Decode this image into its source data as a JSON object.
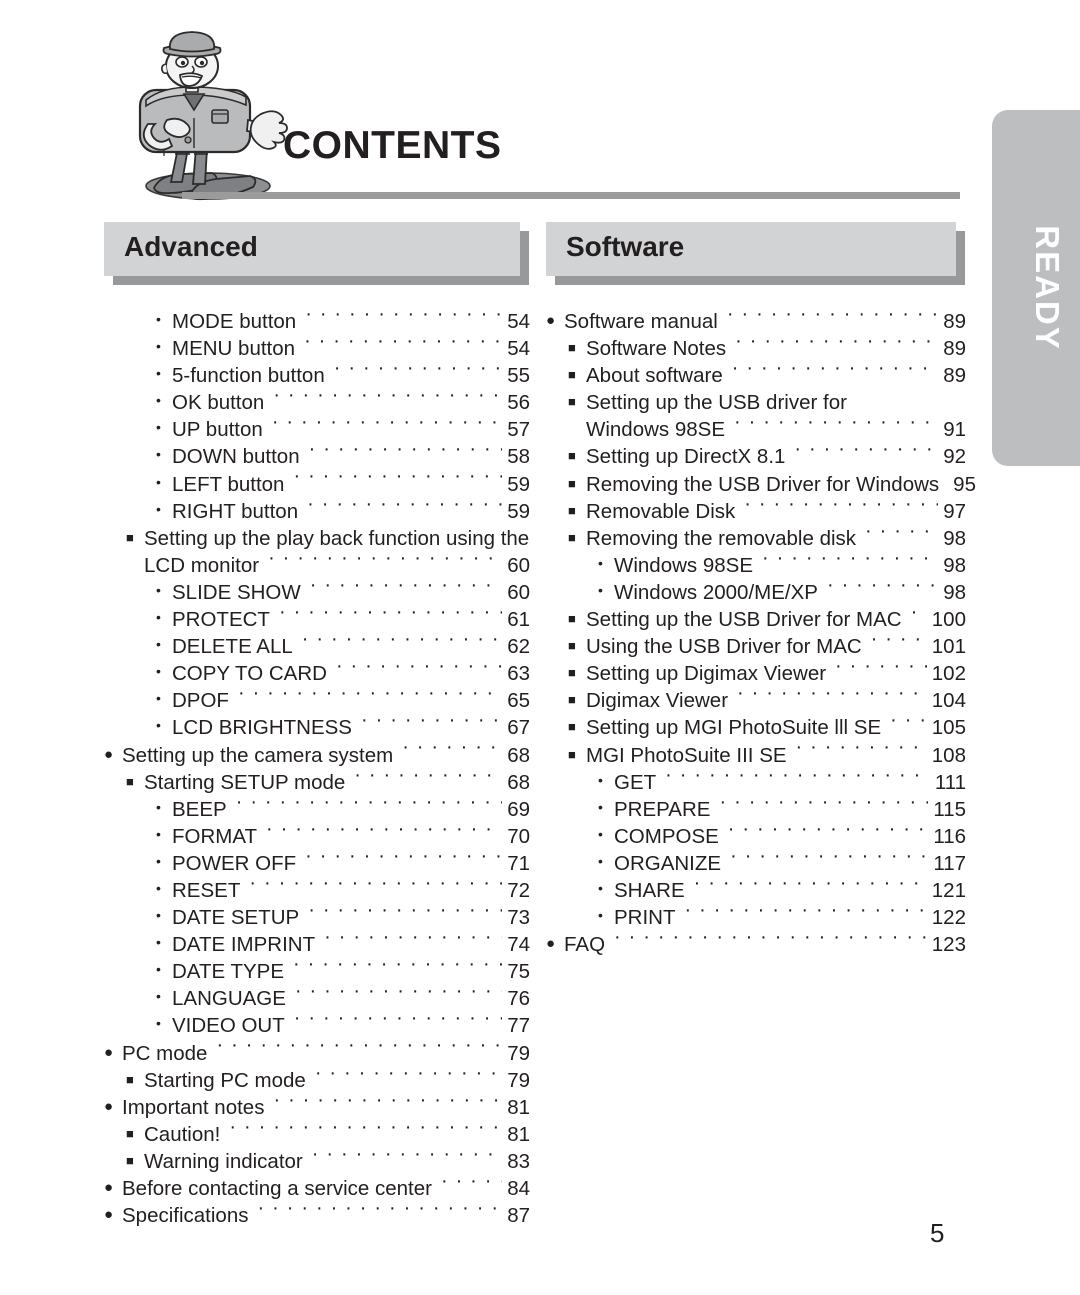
{
  "header": {
    "title": "CONTENTS",
    "mascot_icon": "camera-mascot-illustration"
  },
  "side_tab": {
    "label": "READY"
  },
  "sections": [
    {
      "id": "advanced",
      "heading": "Advanced",
      "entries": [
        {
          "level": 3,
          "title": "MODE button",
          "page": "54"
        },
        {
          "level": 3,
          "title": "MENU button",
          "page": "54"
        },
        {
          "level": 3,
          "title": "5-function button",
          "page": "55"
        },
        {
          "level": 3,
          "title": "OK button",
          "page": "56"
        },
        {
          "level": 3,
          "title": "UP button",
          "page": "57"
        },
        {
          "level": 3,
          "title": "DOWN button",
          "page": "58"
        },
        {
          "level": 3,
          "title": "LEFT button",
          "page": "59"
        },
        {
          "level": 3,
          "title": "RIGHT button",
          "page": "59"
        },
        {
          "level": 2,
          "title": "Setting up the play back function using the",
          "page": "",
          "wrap": true
        },
        {
          "level": 2,
          "title": "LCD monitor",
          "page": "60",
          "continuation": true
        },
        {
          "level": 3,
          "title": "SLIDE SHOW",
          "page": "60"
        },
        {
          "level": 3,
          "title": "PROTECT",
          "page": "61"
        },
        {
          "level": 3,
          "title": "DELETE ALL",
          "page": "62"
        },
        {
          "level": 3,
          "title": "COPY TO CARD",
          "page": "63"
        },
        {
          "level": 3,
          "title": "DPOF",
          "page": "65"
        },
        {
          "level": 3,
          "title": "LCD BRIGHTNESS",
          "page": "67"
        },
        {
          "level": 1,
          "title": "Setting up the camera system",
          "page": "68"
        },
        {
          "level": 2,
          "title": "Starting SETUP mode",
          "page": "68"
        },
        {
          "level": 3,
          "title": "BEEP",
          "page": "69"
        },
        {
          "level": 3,
          "title": "FORMAT",
          "page": "70"
        },
        {
          "level": 3,
          "title": "POWER OFF",
          "page": "71"
        },
        {
          "level": 3,
          "title": "RESET",
          "page": "72"
        },
        {
          "level": 3,
          "title": "DATE SETUP",
          "page": "73"
        },
        {
          "level": 3,
          "title": "DATE IMPRINT",
          "page": "74"
        },
        {
          "level": 3,
          "title": "DATE TYPE",
          "page": "75"
        },
        {
          "level": 3,
          "title": "LANGUAGE",
          "page": "76"
        },
        {
          "level": 3,
          "title": "VIDEO OUT",
          "page": "77"
        },
        {
          "level": 1,
          "title": "PC mode",
          "page": "79"
        },
        {
          "level": 2,
          "title": "Starting PC mode",
          "page": "79"
        },
        {
          "level": 1,
          "title": "Important notes",
          "page": "81"
        },
        {
          "level": 2,
          "title": "Caution!",
          "page": "81"
        },
        {
          "level": 2,
          "title": "Warning indicator",
          "page": "83"
        },
        {
          "level": 1,
          "title": "Before contacting a service center",
          "page": "84"
        },
        {
          "level": 1,
          "title": "Specifications",
          "page": "87"
        }
      ]
    },
    {
      "id": "software",
      "heading": "Software",
      "entries": [
        {
          "level": 1,
          "title": "Software manual",
          "page": "89"
        },
        {
          "level": 2,
          "title": "Software Notes",
          "page": "89"
        },
        {
          "level": 2,
          "title": "About software",
          "page": "89"
        },
        {
          "level": 2,
          "title": "Setting up the USB driver for",
          "page": "",
          "wrap": true
        },
        {
          "level": 2,
          "title": "Windows 98SE",
          "page": "91",
          "continuation": true
        },
        {
          "level": 2,
          "title": "Setting up DirectX 8.1",
          "page": "92"
        },
        {
          "level": 2,
          "title": "Removing the USB Driver for Windows",
          "page": "95"
        },
        {
          "level": 2,
          "title": "Removable Disk",
          "page": "97"
        },
        {
          "level": 2,
          "title": "Removing the removable disk",
          "page": "98"
        },
        {
          "level": 3,
          "title": "Windows 98SE",
          "page": "98"
        },
        {
          "level": 3,
          "title": "Windows 2000/ME/XP",
          "page": "98"
        },
        {
          "level": 2,
          "title": "Setting up the USB Driver for MAC",
          "page": "100"
        },
        {
          "level": 2,
          "title": "Using the USB Driver for MAC",
          "page": "101"
        },
        {
          "level": 2,
          "title": "Setting up Digimax Viewer",
          "page": "102"
        },
        {
          "level": 2,
          "title": "Digimax Viewer",
          "page": "104"
        },
        {
          "level": 2,
          "title": "Setting up MGI PhotoSuite lll SE",
          "page": "105"
        },
        {
          "level": 2,
          "title": "MGI PhotoSuite III SE",
          "page": "108"
        },
        {
          "level": 3,
          "title": "GET",
          "page": "111"
        },
        {
          "level": 3,
          "title": "PREPARE",
          "page": "115"
        },
        {
          "level": 3,
          "title": "COMPOSE",
          "page": "116"
        },
        {
          "level": 3,
          "title": "ORGANIZE",
          "page": "117"
        },
        {
          "level": 3,
          "title": "SHARE",
          "page": "121"
        },
        {
          "level": 3,
          "title": "PRINT",
          "page": "122"
        },
        {
          "level": 1,
          "title": "FAQ",
          "page": "123"
        }
      ]
    }
  ],
  "footer": {
    "page_number": "5"
  },
  "colors": {
    "section_header_bg": "#d2d3d5",
    "section_header_shadow": "#97999b",
    "rule": "#9b9b9b",
    "tab_bg": "#bcbec0",
    "text": "#231f20"
  }
}
